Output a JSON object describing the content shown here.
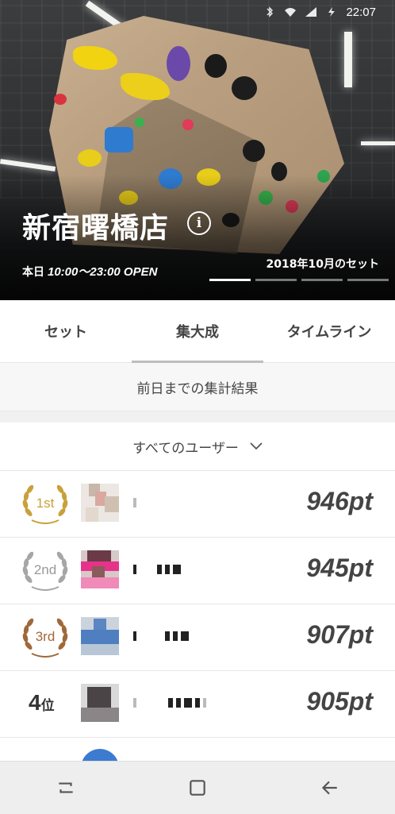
{
  "status_bar": {
    "time": "22:07"
  },
  "store": {
    "name": "新宿曙橋店",
    "hours_prefix": "本日",
    "hours": "10:00～23:00 OPEN",
    "set_label": "2018年10月のセット",
    "pager": {
      "total": 4,
      "active_index": 0
    }
  },
  "tabs": [
    {
      "label": "セット",
      "active": false
    },
    {
      "label": "集大成",
      "active": true
    },
    {
      "label": "タイムライン",
      "active": false
    }
  ],
  "summary_label": "前日までの集計結果",
  "filter": {
    "label": "すべてのユーザー",
    "icon": "chevron-down-icon"
  },
  "ranking": [
    {
      "rank_label": "1st",
      "medal": "gold",
      "score": "946pt"
    },
    {
      "rank_label": "2nd",
      "medal": "silver",
      "score": "945pt"
    },
    {
      "rank_label": "3rd",
      "medal": "bronze",
      "score": "907pt"
    },
    {
      "rank_label": "4",
      "rank_suffix": "位",
      "medal": "none",
      "score": "905pt"
    }
  ],
  "colors": {
    "gold": "#c9a13b",
    "silver": "#a6a6a6",
    "bronze": "#a0683a",
    "navbar": "#eeeeee"
  },
  "navbar": [
    "recent-apps-icon",
    "home-icon",
    "back-icon"
  ]
}
